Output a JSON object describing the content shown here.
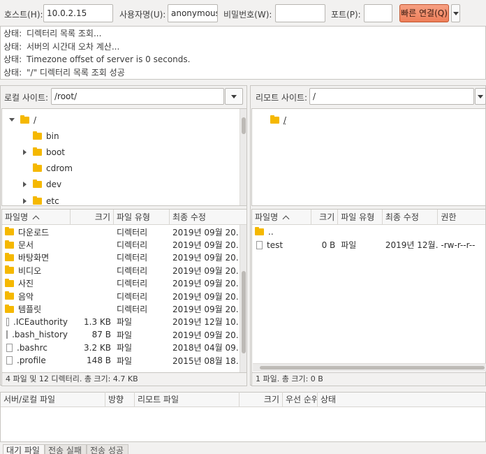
{
  "quickconnect": {
    "host_label": "호스트(H):",
    "host_value": "10.0.2.15",
    "user_label": "사용자명(U):",
    "user_value": "anonymous",
    "pass_label": "비밀번호(W):",
    "pass_value": "",
    "port_label": "포트(P):",
    "port_value": "",
    "connect_label": "빠른 연결(Q)"
  },
  "log": [
    {
      "label": "상태:",
      "text": "디렉터리 목록 조회..."
    },
    {
      "label": "상태:",
      "text": "서버의 시간대 오차 계산..."
    },
    {
      "label": "상태:",
      "text": "Timezone offset of server is 0 seconds."
    },
    {
      "label": "상태:",
      "text": "\"/\" 디렉터리 목록 조회 성공"
    }
  ],
  "local": {
    "site_label": "로컬 사이트:",
    "site_path": "/root/",
    "tree": [
      {
        "name": "/",
        "expander": "down"
      },
      {
        "name": "bin",
        "expander": "none"
      },
      {
        "name": "boot",
        "expander": "right"
      },
      {
        "name": "cdrom",
        "expander": "none"
      },
      {
        "name": "dev",
        "expander": "right"
      },
      {
        "name": "etc",
        "expander": "right"
      }
    ],
    "columns": [
      "파일명",
      "크기",
      "파일 유형",
      "최종 수정"
    ],
    "files": [
      {
        "name": "다운로드",
        "size": "",
        "type": "디렉터리",
        "modified": "2019년 09월 20…",
        "icon": "folder"
      },
      {
        "name": "문서",
        "size": "",
        "type": "디렉터리",
        "modified": "2019년 09월 20…",
        "icon": "folder"
      },
      {
        "name": "바탕화면",
        "size": "",
        "type": "디렉터리",
        "modified": "2019년 09월 20…",
        "icon": "folder"
      },
      {
        "name": "비디오",
        "size": "",
        "type": "디렉터리",
        "modified": "2019년 09월 20…",
        "icon": "folder"
      },
      {
        "name": "사진",
        "size": "",
        "type": "디렉터리",
        "modified": "2019년 09월 20…",
        "icon": "folder"
      },
      {
        "name": "음악",
        "size": "",
        "type": "디렉터리",
        "modified": "2019년 09월 20…",
        "icon": "folder"
      },
      {
        "name": "템플릿",
        "size": "",
        "type": "디렉터리",
        "modified": "2019년 09월 20…",
        "icon": "folder"
      },
      {
        "name": ".ICEauthority",
        "size": "1.3 KB",
        "type": "파일",
        "modified": "2019년 12월 10…",
        "icon": "file"
      },
      {
        "name": ".bash_history",
        "size": "87 B",
        "type": "파일",
        "modified": "2019년 09월 20…",
        "icon": "file"
      },
      {
        "name": ".bashrc",
        "size": "3.2 KB",
        "type": "파일",
        "modified": "2018년 04월 09…",
        "icon": "file"
      },
      {
        "name": ".profile",
        "size": "148 B",
        "type": "파일",
        "modified": "2015년 08월 18…",
        "icon": "file"
      }
    ],
    "status": "4 파일 및 12 디렉터리. 총 크기: 4.7 KB"
  },
  "remote": {
    "site_label": "리모트 사이트:",
    "site_path": "/",
    "tree": [
      {
        "name": "/"
      }
    ],
    "columns": [
      "파일명",
      "크기",
      "파일 유형",
      "최종 수정",
      "권한"
    ],
    "files": [
      {
        "name": "..",
        "size": "",
        "type": "",
        "modified": "",
        "perms": "",
        "icon": "folder"
      },
      {
        "name": "test",
        "size": "0 B",
        "type": "파일",
        "modified": "2019년 12월…",
        "perms": "-rw-r--r--",
        "icon": "file"
      }
    ],
    "status": "1 파일. 총 크기: 0 B"
  },
  "queue": {
    "columns": [
      "서버/로컬 파일",
      "방향",
      "리모트 파일",
      "크기",
      "우선 순위",
      "상태"
    ],
    "tabs": [
      "대기 파일",
      "전송 실패",
      "전송 성공"
    ]
  }
}
